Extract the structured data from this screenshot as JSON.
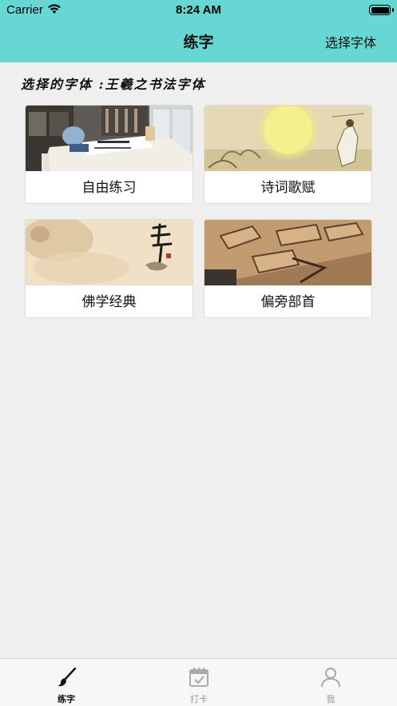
{
  "status_bar": {
    "carrier": "Carrier",
    "time": "8:24 AM",
    "battery_level": 1.0
  },
  "nav": {
    "title": "练字",
    "action": "选择字体"
  },
  "selected_font": {
    "text": "选择的字体 :王羲之书法字体"
  },
  "cards": [
    {
      "label": "自由练习",
      "image": "desk-scene-image"
    },
    {
      "label": "诗词歌赋",
      "image": "moon-poet-painting-image"
    },
    {
      "label": "佛学经典",
      "image": "zen-calligraphy-image"
    },
    {
      "label": "偏旁部首",
      "image": "wooden-radical-blocks-image"
    }
  ],
  "tabs": [
    {
      "label": "练字",
      "icon": "brush-icon",
      "active": true
    },
    {
      "label": "打卡",
      "icon": "calendar-check-icon",
      "active": false
    },
    {
      "label": "我",
      "icon": "person-icon",
      "active": false
    }
  ],
  "colors": {
    "header": "#67d7d4",
    "background": "#efefef",
    "tab_active": "#111111",
    "tab_inactive": "#999999"
  }
}
